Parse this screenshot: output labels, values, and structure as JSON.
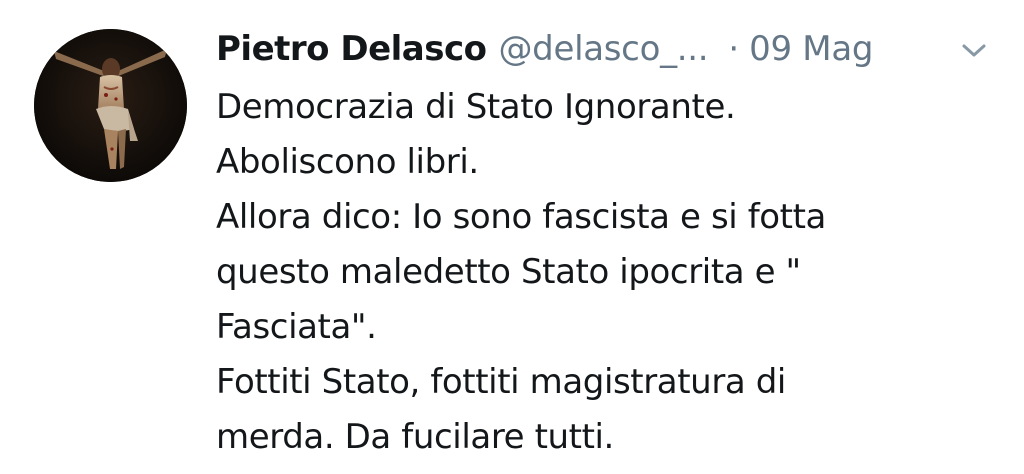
{
  "tweet": {
    "author_name": "Pietro Delasco",
    "author_handle": "@delasco_...",
    "separator": "·",
    "timestamp": "09 Mag",
    "menu_icon": "chevron-down-icon",
    "avatar_icon": "crucifix-avatar",
    "text_lines": [
      "Democrazia di Stato Ignorante.",
      "Aboliscono libri.",
      "Allora dico: Io sono fascista e si fotta",
      "questo maledetto Stato ipocrita e \"",
      "Fasciata\".",
      "Fottiti Stato, fottiti magistratura di",
      "merda. Da fucilare tutti."
    ]
  },
  "colors": {
    "text_primary": "#14171a",
    "text_secondary": "#657786",
    "background": "#ffffff",
    "chevron": "#8899a6"
  }
}
